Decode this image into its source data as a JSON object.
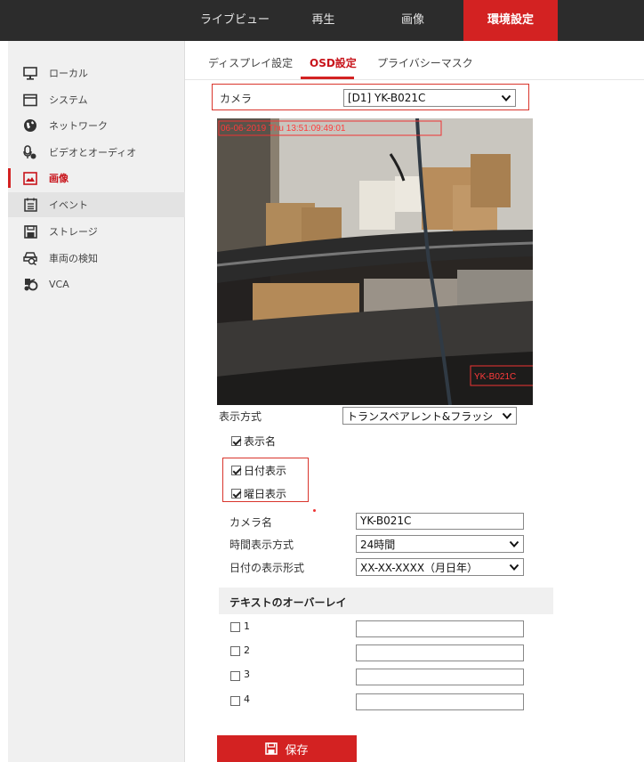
{
  "topnav": [
    {
      "label": "ライブビュー",
      "active": false
    },
    {
      "label": "再生",
      "active": false
    },
    {
      "label": "画像",
      "active": false
    },
    {
      "label": "環境設定",
      "active": true
    }
  ],
  "sidebar": {
    "items": [
      {
        "label": "ローカル",
        "icon": "monitor-icon"
      },
      {
        "label": "システム",
        "icon": "system-icon"
      },
      {
        "label": "ネットワーク",
        "icon": "globe-icon"
      },
      {
        "label": "ビデオとオーディオ",
        "icon": "video-audio-icon"
      },
      {
        "label": "画像",
        "icon": "image-icon",
        "active": true
      },
      {
        "label": "イベント",
        "icon": "calendar-icon"
      },
      {
        "label": "ストレージ",
        "icon": "storage-icon"
      },
      {
        "label": "車両の検知",
        "icon": "vehicle-detect-icon"
      },
      {
        "label": "VCA",
        "icon": "vca-icon"
      }
    ]
  },
  "subtabs": [
    {
      "label": "ディスプレイ設定"
    },
    {
      "label": "OSD設定",
      "active": true
    },
    {
      "label": "プライバシーマスク"
    }
  ],
  "camera": {
    "label": "カメラ",
    "value": "[D1] YK-B021C"
  },
  "video": {
    "timestamp": "06-06-2019 Thu 13:51:09:49:01",
    "osd_name": "YK-B021C"
  },
  "display_mode": {
    "label": "表示方式",
    "value": "トランスペアレント&フラッシ"
  },
  "checkboxes": [
    {
      "label": "表示名",
      "checked": true
    },
    {
      "label": "日付表示",
      "checked": true
    },
    {
      "label": "曜日表示",
      "checked": true
    }
  ],
  "camera_name": {
    "label": "カメラ名",
    "value": "YK-B021C"
  },
  "time_format": {
    "label": "時間表示方式",
    "value": "24時間"
  },
  "date_format": {
    "label": "日付の表示形式",
    "value": "XX-XX-XXXX（月日年）"
  },
  "text_overlay": {
    "title": "テキストのオーバーレイ",
    "rows": [
      {
        "label": "1",
        "checked": false,
        "value": ""
      },
      {
        "label": "2",
        "checked": false,
        "value": ""
      },
      {
        "label": "3",
        "checked": false,
        "value": ""
      },
      {
        "label": "4",
        "checked": false,
        "value": ""
      }
    ]
  },
  "save_label": "保存",
  "colors": {
    "accent": "#d32222",
    "topbar": "#2c2c2c",
    "sidebar": "#f0f0f0"
  }
}
